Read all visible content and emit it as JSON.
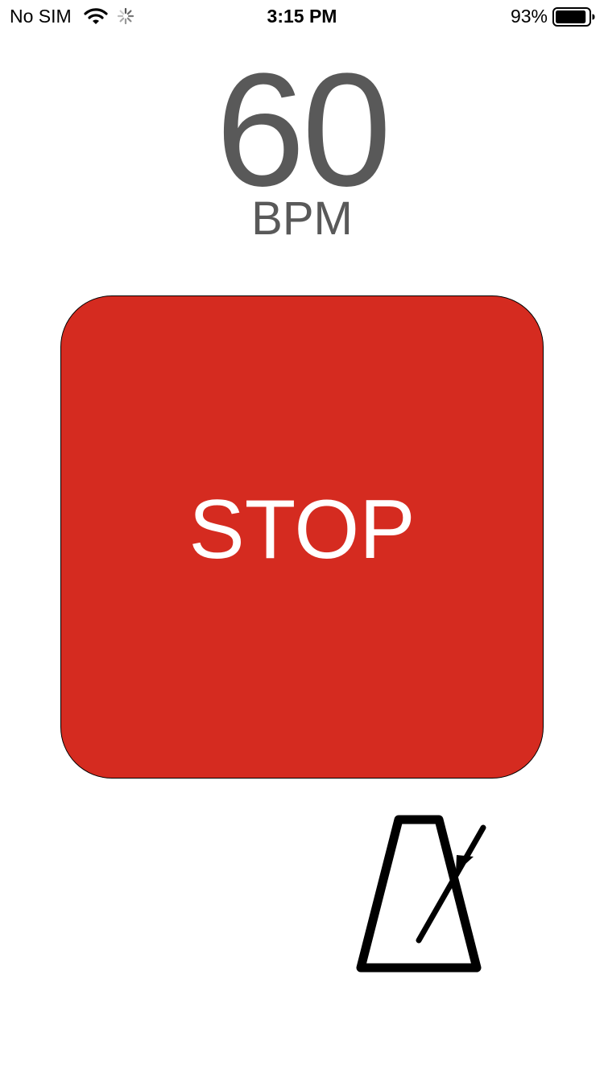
{
  "status_bar": {
    "carrier": "No SIM",
    "time": "3:15 PM",
    "battery_percent": "93%",
    "battery_level": 0.93,
    "icons": [
      "wifi-icon",
      "activity-spinner-icon",
      "battery-icon"
    ]
  },
  "tempo": {
    "value": "60",
    "unit": "BPM"
  },
  "stop_button": {
    "label": "STOP"
  },
  "metronome_button": {
    "icon": "metronome-icon"
  },
  "colors": {
    "stop_button": "#d52b20",
    "tempo_text": "#595959",
    "stop_text": "#ffffff",
    "background": "#ffffff"
  }
}
